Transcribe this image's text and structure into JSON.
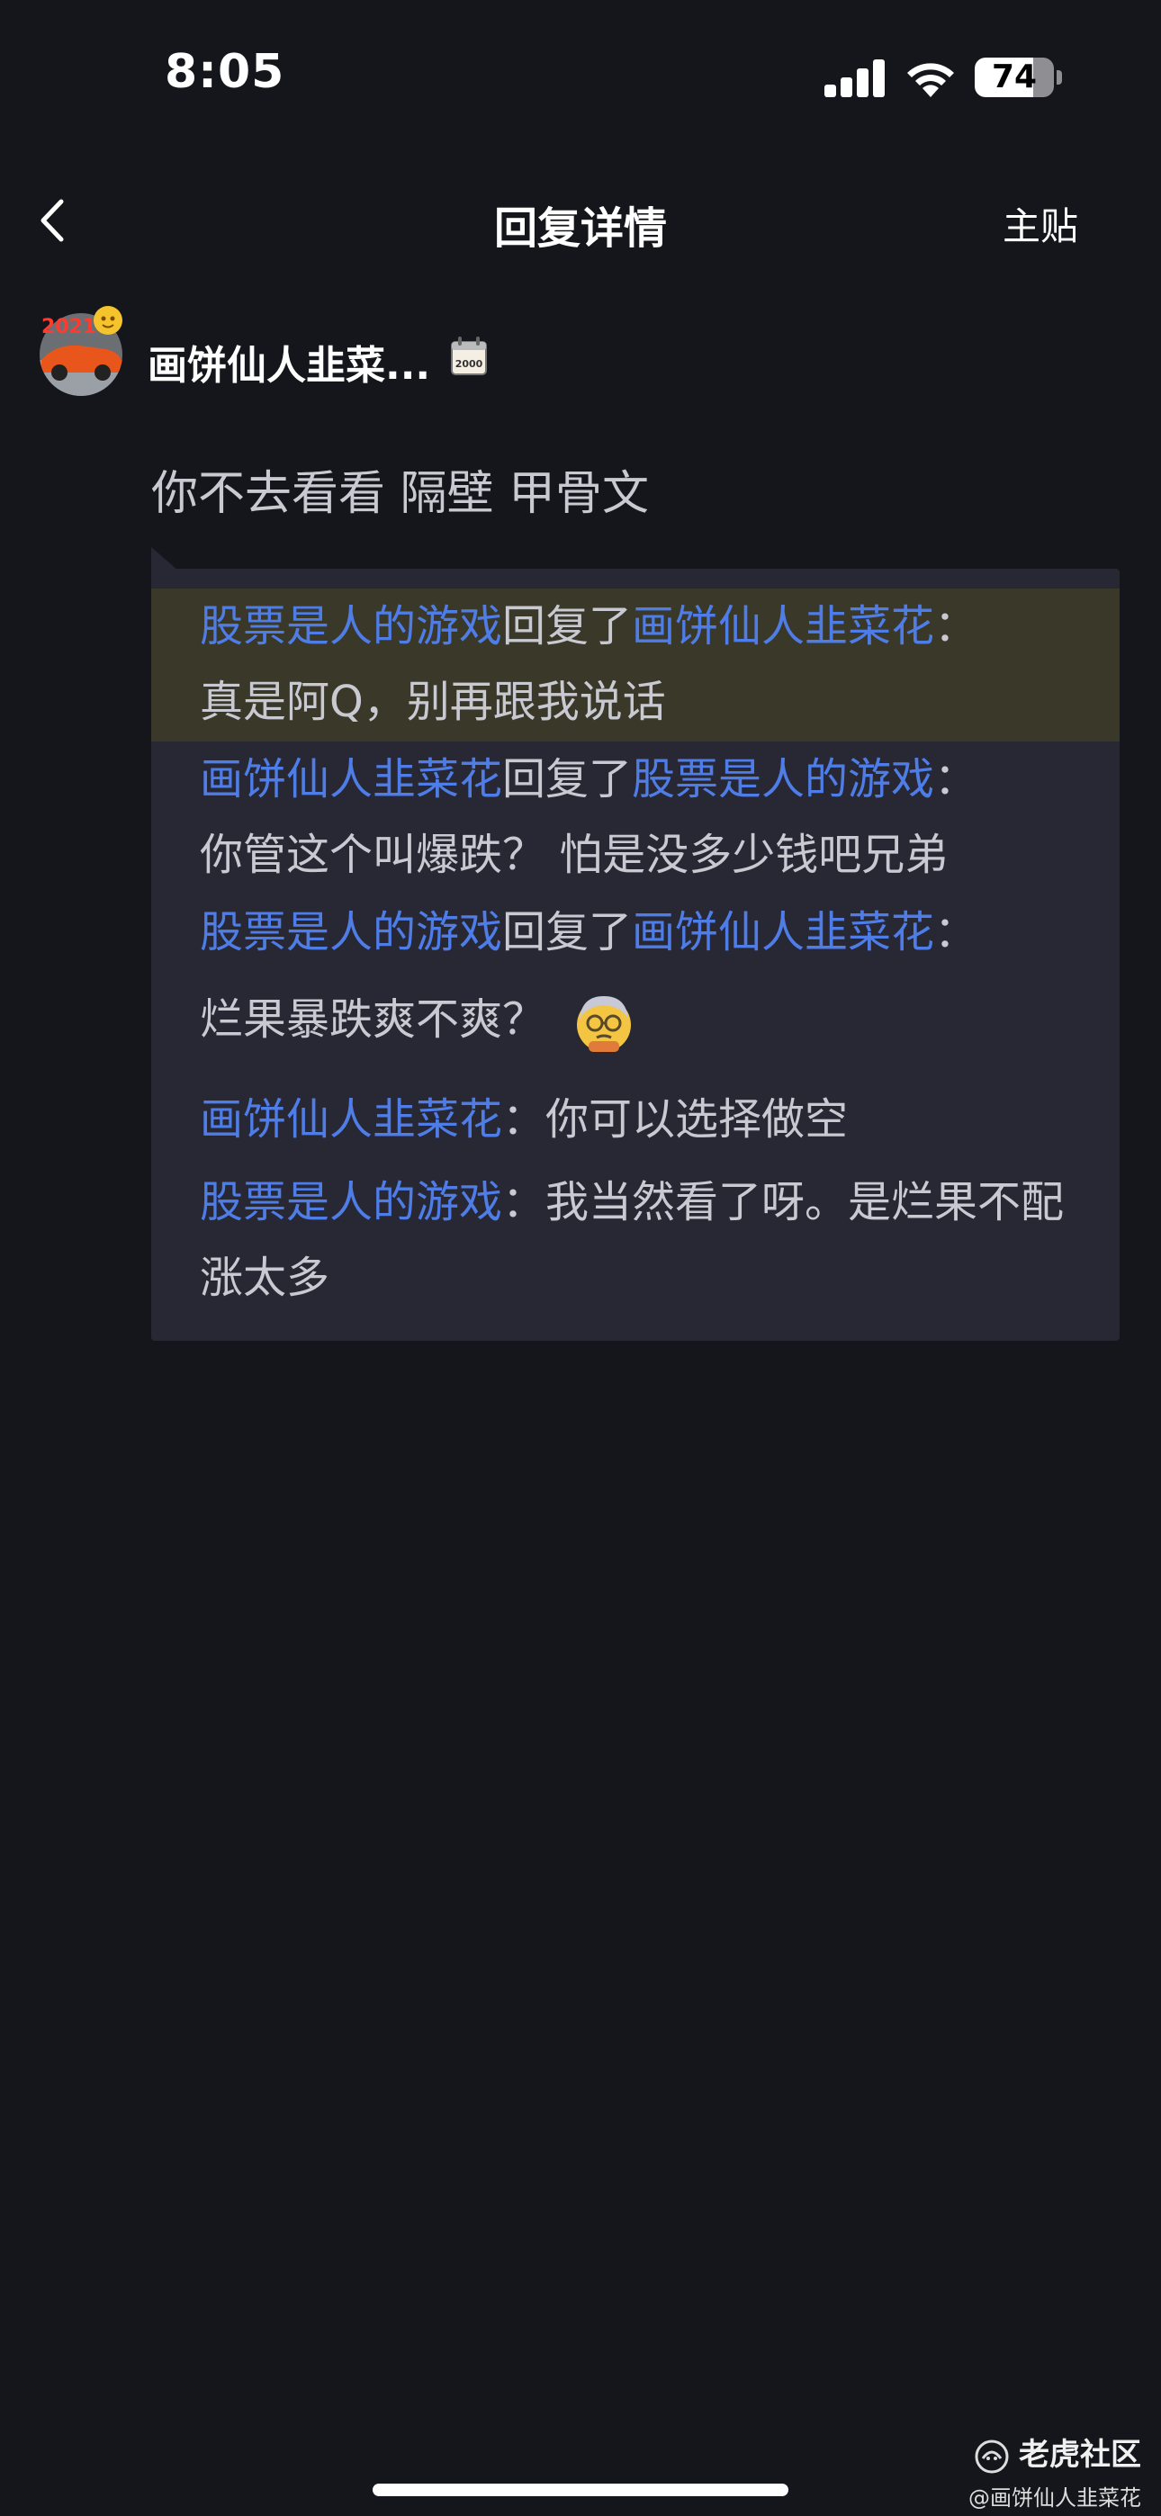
{
  "status_bar": {
    "time": "8:05",
    "battery": "74",
    "battery_level": 0.74
  },
  "nav": {
    "title": "回复详情",
    "main_post_label": "主贴"
  },
  "author": {
    "name": "画饼仙人韭菜...",
    "avatar_badge": "2021",
    "level_badge": "2000"
  },
  "comment": {
    "text": "你不去看看 隔壁 甲骨文"
  },
  "replies": [
    {
      "from": "股票是人的游戏",
      "verb": "回复了",
      "to": "画饼仙人韭菜花",
      "sep": "：",
      "text": "真是阿Q，别再跟我说话",
      "highlight": true
    },
    {
      "from": "画饼仙人韭菜花",
      "verb": "回复了",
      "to": "股票是人的游戏",
      "sep": "：",
      "text": "你管这个叫爆跌？ 怕是没多少钱吧兄弟",
      "highlight": false
    },
    {
      "from": "股票是人的游戏",
      "verb": "回复了",
      "to": "画饼仙人韭菜花",
      "sep": "：",
      "text": "烂果暴跌爽不爽？",
      "emoji": "thinking-face-emoji",
      "highlight": false
    },
    {
      "from": "画饼仙人韭菜花",
      "sep": "：",
      "text": "你可以选择做空",
      "highlight": false
    },
    {
      "from": "股票是人的游戏",
      "sep": "：",
      "text": "我当然看了呀。是烂果不配涨太多",
      "highlight": false
    }
  ],
  "watermark": {
    "site": "老虎社区",
    "user": "@画饼仙人韭菜花"
  },
  "colors": {
    "background": "#15161b",
    "reply_box": "#272833",
    "highlight": "#3a3829",
    "username_link": "#4f7de8"
  }
}
